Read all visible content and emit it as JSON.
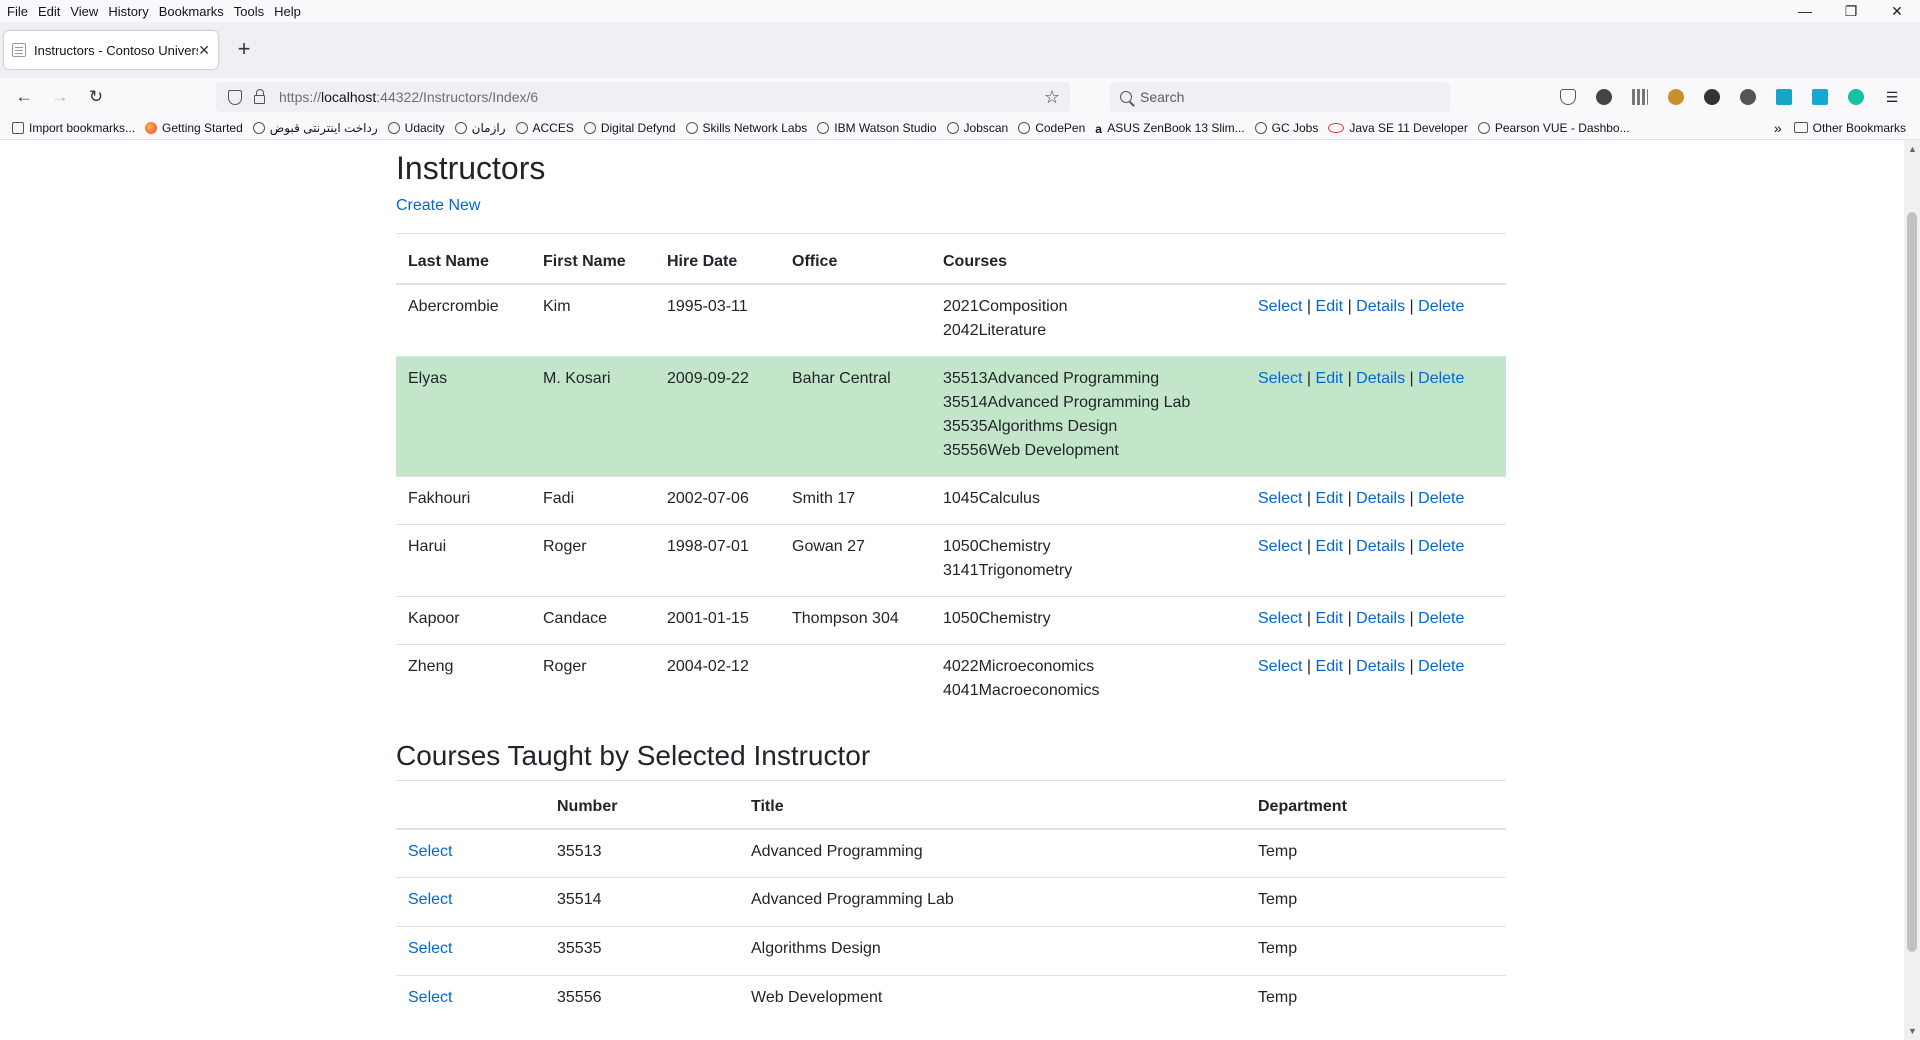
{
  "browser": {
    "menu": [
      "File",
      "Edit",
      "View",
      "History",
      "Bookmarks",
      "Tools",
      "Help"
    ],
    "window_controls": [
      "—",
      "❐",
      "✕"
    ],
    "tab_title": "Instructors - Contoso University",
    "url_prefix": "https://",
    "url_host": "localhost",
    "url_rest": ":44322/Instructors/Index/6",
    "search_placeholder": "Search",
    "bookmarks": [
      {
        "label": "Import bookmarks...",
        "icon": "import"
      },
      {
        "label": "Getting Started",
        "icon": "firefox"
      },
      {
        "label": "رداخت اینترنتی قبوض",
        "icon": "globe"
      },
      {
        "label": "Udacity",
        "icon": "globe"
      },
      {
        "label": "رازمان",
        "icon": "globe"
      },
      {
        "label": "ACCES",
        "icon": "globe"
      },
      {
        "label": "Digital Defynd",
        "icon": "globe"
      },
      {
        "label": "Skills Network Labs",
        "icon": "globe"
      },
      {
        "label": "IBM Watson Studio",
        "icon": "globe"
      },
      {
        "label": "Jobscan",
        "icon": "globe"
      },
      {
        "label": "CodePen",
        "icon": "globe"
      },
      {
        "label": "ASUS ZenBook 13 Slim...",
        "icon": "amazon"
      },
      {
        "label": "GC Jobs",
        "icon": "globe"
      },
      {
        "label": "Java SE 11 Developer",
        "icon": "java"
      },
      {
        "label": "Pearson VUE - Dashbo...",
        "icon": "globe"
      }
    ],
    "other_bookmarks": "Other Bookmarks"
  },
  "page": {
    "title": "Instructors",
    "create_new": "Create New",
    "instructor_headers": [
      "Last Name",
      "First Name",
      "Hire Date",
      "Office",
      "Courses",
      ""
    ],
    "instructors": [
      {
        "last": "Abercrombie",
        "first": "Kim",
        "hire": "1995-03-11",
        "office": "",
        "courses": [
          "2021Composition",
          "2042Literature"
        ],
        "selected": false
      },
      {
        "last": "Elyas",
        "first": "M. Kosari",
        "hire": "2009-09-22",
        "office": "Bahar Central",
        "courses": [
          "35513Advanced Programming",
          "35514Advanced Programming Lab",
          "35535Algorithms Design",
          "35556Web Development"
        ],
        "selected": true
      },
      {
        "last": "Fakhouri",
        "first": "Fadi",
        "hire": "2002-07-06",
        "office": "Smith 17",
        "courses": [
          "1045Calculus"
        ],
        "selected": false
      },
      {
        "last": "Harui",
        "first": "Roger",
        "hire": "1998-07-01",
        "office": "Gowan 27",
        "courses": [
          "1050Chemistry",
          "3141Trigonometry"
        ],
        "selected": false
      },
      {
        "last": "Kapoor",
        "first": "Candace",
        "hire": "2001-01-15",
        "office": "Thompson 304",
        "courses": [
          "1050Chemistry"
        ],
        "selected": false
      },
      {
        "last": "Zheng",
        "first": "Roger",
        "hire": "2004-02-12",
        "office": "",
        "courses": [
          "4022Microeconomics",
          "4041Macroeconomics"
        ],
        "selected": false
      }
    ],
    "row_actions": [
      "Select",
      "Edit",
      "Details",
      "Delete"
    ],
    "action_separator": "|",
    "courses_title": "Courses Taught by Selected Instructor",
    "course_headers": [
      "",
      "Number",
      "Title",
      "Department"
    ],
    "courses": [
      {
        "action": "Select",
        "number": "35513",
        "title": "Advanced Programming",
        "department": "Temp"
      },
      {
        "action": "Select",
        "number": "35514",
        "title": "Advanced Programming Lab",
        "department": "Temp"
      },
      {
        "action": "Select",
        "number": "35535",
        "title": "Algorithms Design",
        "department": "Temp"
      },
      {
        "action": "Select",
        "number": "35556",
        "title": "Web Development",
        "department": "Temp"
      }
    ]
  },
  "colors": {
    "link": "#0366d6",
    "selected_row": "#c3e6cb",
    "border": "#dee2e6"
  }
}
